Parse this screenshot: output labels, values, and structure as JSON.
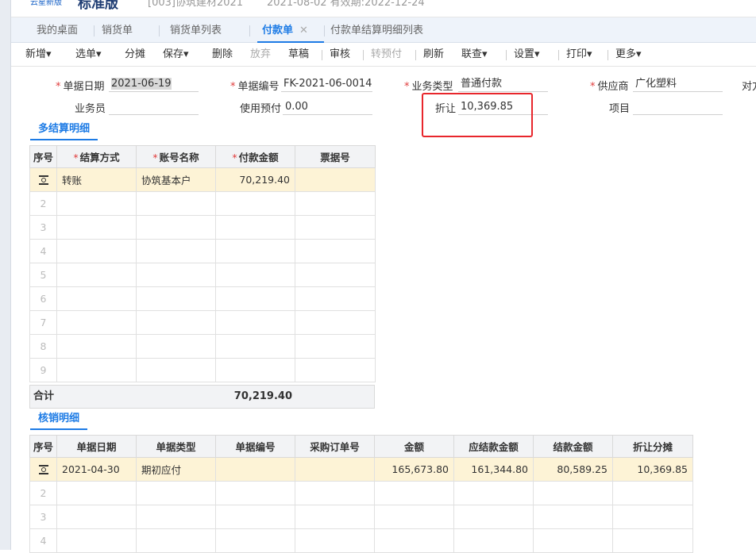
{
  "header": {
    "brand_small": "云星新版",
    "brand_main": "标准版",
    "account": "[003]协筑建材2021",
    "dates": "2021-08-02   有效期:2022-12-24"
  },
  "tabs": [
    {
      "label": "我的桌面"
    },
    {
      "label": "销货单"
    },
    {
      "label": "销货单列表"
    },
    {
      "label": "付款单",
      "close": "✕"
    },
    {
      "label": "付款单结算明细列表"
    }
  ],
  "toolbar": {
    "add": "新增",
    "select": "选单",
    "allocate": "分摊",
    "save": "保存",
    "delete": "删除",
    "discard": "放弃",
    "draft": "草稿",
    "audit": "审核",
    "convert_prepay": "转预付",
    "refresh": "刷新",
    "linked_query": "联查",
    "settings": "设置",
    "print": "打印",
    "more": "更多",
    "caret": "▾"
  },
  "form": {
    "doc_date_label": "单据日期",
    "doc_date": "2021-06-19",
    "doc_no_label": "单据编号",
    "doc_no": "FK-2021-06-0014",
    "biz_type_label": "业务类型",
    "biz_type": "普通付款",
    "supplier_label": "供应商",
    "supplier": "广化塑料",
    "overflow_label": "对方",
    "salesman_label": "业务员",
    "salesman": "",
    "use_prepay_label": "使用预付",
    "use_prepay": "0.00",
    "discount_label": "折让",
    "discount": "10,369.85",
    "project_label": "项目",
    "project": "",
    "required_mark": "*"
  },
  "settlement": {
    "title": "多结算明细",
    "headers": [
      "序号",
      "结算方式",
      "账号名称",
      "付款金额",
      "票据号"
    ],
    "rows": [
      {
        "idx": "",
        "method": "转账",
        "account": "协筑基本户",
        "amount": "70,219.40",
        "bill": ""
      },
      {
        "idx": "2"
      },
      {
        "idx": "3"
      },
      {
        "idx": "4"
      },
      {
        "idx": "5"
      },
      {
        "idx": "6"
      },
      {
        "idx": "7"
      },
      {
        "idx": "8"
      },
      {
        "idx": "9"
      }
    ],
    "total_label": "合计",
    "total_amount": "70,219.40"
  },
  "writeoff": {
    "title": "核销明细",
    "headers": [
      "序号",
      "单据日期",
      "单据类型",
      "单据编号",
      "采购订单号",
      "金额",
      "应结款金额",
      "结款金额",
      "折让分摊"
    ],
    "rows": [
      {
        "date": "2021-04-30",
        "type": "期初应付",
        "no": "",
        "po": "",
        "amount": "165,673.80",
        "due": "161,344.80",
        "paid": "80,589.25",
        "discount": "10,369.85"
      },
      {
        "idx": "2"
      },
      {
        "idx": "3"
      },
      {
        "idx": "4"
      }
    ]
  },
  "colors": {
    "accent": "#1d7be5",
    "highlight_box": "#e8262c",
    "selected_row": "#fdf3d6"
  }
}
